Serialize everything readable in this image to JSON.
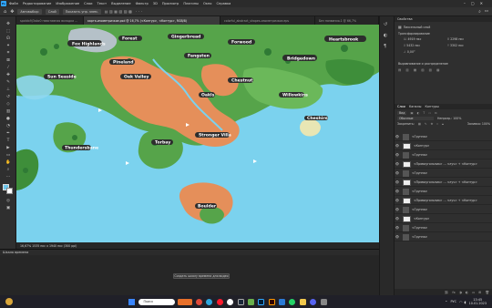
{
  "menu": [
    "Файл",
    "Редактирование",
    "Изображение",
    "Слои",
    "Текст",
    "Выделение",
    "Фильтр",
    "3D",
    "Просмотр",
    "Плагины",
    "Окно",
    "Справка"
  ],
  "options": {
    "tool": "Автовыбор:",
    "target": "Слой",
    "transform": "Показать упр. элем."
  },
  "tabs": [
    {
      "label": "spotdx9j3abc0 неактивная вкладка ...",
      "active": false
    },
    {
      "label": "карта-изометричкое.psd @ 16,7% (<Контур>, <Контур>, RGB/8)",
      "active": true
    },
    {
      "label": "colorful_abstract_shapes-изометричкое.eps",
      "active": false
    },
    {
      "label": "Без названия-1 @ 66,7%",
      "active": false
    }
  ],
  "map_labels": [
    "Fox Highlands",
    "Forest",
    "Gingerbread",
    "Forwood",
    "Heartsbrook",
    "Pineland",
    "Fangsten",
    "Bridgedown",
    "Sun Seaside",
    "Oak Valley",
    "Oakls",
    "Chestnut",
    "Willowkins",
    "Thundersbane",
    "Stronger Villa",
    "Torbay",
    "Boulder",
    "Cheshire"
  ],
  "properties": {
    "title": "Свойства",
    "subtitle": "Пиксельный слой",
    "width": "4919 пкс",
    "height": "2298 пкс",
    "x": "5432 пкс",
    "y": "3302 пкс",
    "angle": "0,00°",
    "align_label": "Выравнивание и распределение",
    "panel_label": "Трансформирование"
  },
  "layers": {
    "tabs": [
      "Слои",
      "Каналы",
      "Контуры"
    ],
    "kind": "Вид",
    "blend": "Обычные",
    "opacity": "Непрозр.: 100%",
    "fill": "Заливка: 100%",
    "lock": "Закрепить:",
    "items": [
      {
        "name": "<Группа>"
      },
      {
        "name": "<Контур>"
      },
      {
        "name": "<Группа>"
      },
      {
        "name": "<Прямоугольник> ... <луч> + <Контур>"
      },
      {
        "name": "<Группа>"
      },
      {
        "name": "<Прямоугольник> ... <луч> + <Контур>"
      },
      {
        "name": "<Группа>"
      },
      {
        "name": "<Прямоугольник> ... <луч> + <Контур>"
      },
      {
        "name": "<Группа>"
      },
      {
        "name": "<Контур>"
      },
      {
        "name": "<Группа>"
      },
      {
        "name": "<Группа>"
      }
    ]
  },
  "status": "16,67%   1535 пкс x 1940 пкс (300 ppi)",
  "timeline": {
    "title": "Шкала времени",
    "button": "Создать шкалу времени для видео"
  },
  "taskbar": {
    "search": "Поиск",
    "time": "13:45",
    "date": "10.01.2023",
    "lang": "РУС"
  },
  "colors": {
    "ocean": "#7bd2ee",
    "land": "#56a44a",
    "mountain": "#e58f5a",
    "accent": "#2f6cd6"
  }
}
